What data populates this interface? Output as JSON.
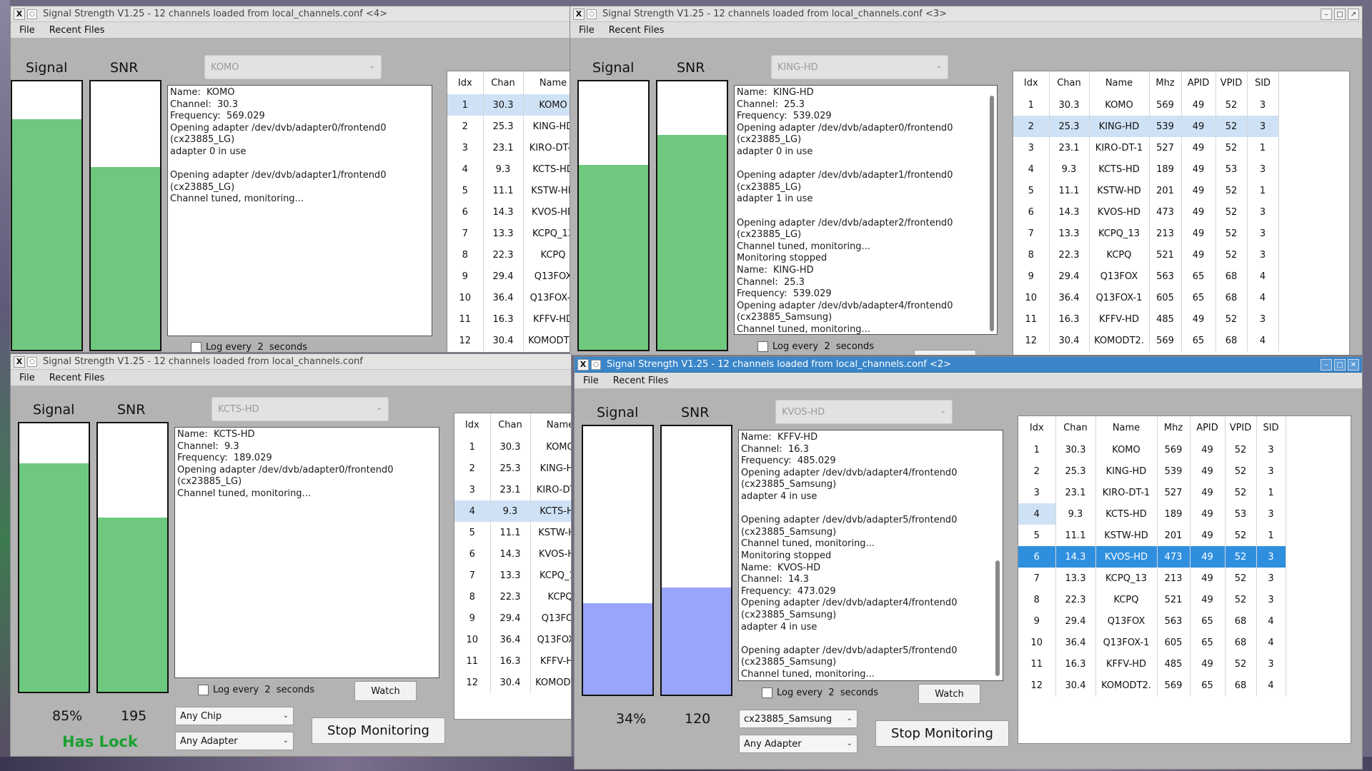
{
  "menu": {
    "file": "File",
    "recent": "Recent Files"
  },
  "labels": {
    "signal": "Signal",
    "snr": "SNR",
    "log_every": "Log every",
    "log_seconds": "2",
    "seconds": "seconds",
    "watch": "Watch",
    "stop": "Stop Monitoring",
    "has_lock": "Has Lock"
  },
  "colors": {
    "signal_fill_locked": "#6ec97f",
    "signal_fill_unlocked": "#99a4fb",
    "selected_row": "#2f8fdf",
    "lock_text": "#1aa030"
  },
  "table": {
    "headers": [
      "Idx",
      "Chan",
      "Name",
      "Mhz",
      "APID",
      "VPID",
      "SID"
    ],
    "rows": [
      [
        "1",
        "30.3",
        "KOMO",
        "569",
        "49",
        "52",
        "3"
      ],
      [
        "2",
        "25.3",
        "KING-HD",
        "539",
        "49",
        "52",
        "3"
      ],
      [
        "3",
        "23.1",
        "KIRO-DT-1",
        "527",
        "49",
        "52",
        "1"
      ],
      [
        "4",
        "9.3",
        "KCTS-HD",
        "189",
        "49",
        "53",
        "3"
      ],
      [
        "5",
        "11.1",
        "KSTW-HD",
        "201",
        "49",
        "52",
        "1"
      ],
      [
        "6",
        "14.3",
        "KVOS-HD",
        "473",
        "49",
        "52",
        "3"
      ],
      [
        "7",
        "13.3",
        "KCPQ_13",
        "213",
        "49",
        "52",
        "3"
      ],
      [
        "8",
        "22.3",
        "KCPQ",
        "521",
        "49",
        "52",
        "3"
      ],
      [
        "9",
        "29.4",
        "Q13FOX",
        "563",
        "65",
        "68",
        "4"
      ],
      [
        "10",
        "36.4",
        "Q13FOX-1",
        "605",
        "65",
        "68",
        "4"
      ],
      [
        "11",
        "16.3",
        "KFFV-HD",
        "485",
        "49",
        "52",
        "3"
      ],
      [
        "12",
        "30.4",
        "KOMODT2.",
        "569",
        "65",
        "68",
        "4"
      ]
    ]
  },
  "windows": {
    "w4": {
      "title": "Signal Strength V1.25 - 12 channels loaded from local_channels.conf <4>",
      "channel": "KOMO",
      "signal_level": 0.86,
      "snr_level": 0.68,
      "log": [
        "Name:  KOMO",
        "Channel:  30.3",
        "Frequency:  569.029",
        "Opening adapter /dev/dvb/adapter0/frontend0",
        "(cx23885_LG)",
        "adapter 0 in use",
        "",
        "Opening adapter /dev/dvb/adapter1/frontend0",
        "(cx23885_LG)",
        "Channel tuned, monitoring..."
      ],
      "selected_row": 0
    },
    "w3": {
      "title": "Signal Strength V1.25 - 12 channels loaded from local_channels.conf <3>",
      "channel": "KING-HD",
      "signal_level": 0.69,
      "snr_level": 0.8,
      "log": [
        "Name:  KING-HD",
        "Channel:  25.3",
        "Frequency:  539.029",
        "Opening adapter /dev/dvb/adapter0/frontend0",
        "(cx23885_LG)",
        "adapter 0 in use",
        "",
        "Opening adapter /dev/dvb/adapter1/frontend0",
        "(cx23885_LG)",
        "adapter 1 in use",
        "",
        "Opening adapter /dev/dvb/adapter2/frontend0",
        "(cx23885_LG)",
        "Channel tuned, monitoring...",
        "Monitoring stopped",
        "Name:  KING-HD",
        "Channel:  25.3",
        "Frequency:  539.029",
        "Opening adapter /dev/dvb/adapter4/frontend0",
        "(cx23885_Samsung)",
        "Channel tuned, monitoring..."
      ],
      "selected_row": 1
    },
    "w1": {
      "title": "Signal Strength V1.25 - 12 channels loaded from local_channels.conf",
      "channel": "KCTS-HD",
      "signal_level": 0.85,
      "snr_level": 0.65,
      "signal_text": "85%",
      "snr_text": "195",
      "log": [
        "Name:  KCTS-HD",
        "Channel:  9.3",
        "Frequency:  189.029",
        "Opening adapter /dev/dvb/adapter0/frontend0",
        "(cx23885_LG)",
        "Channel tuned, monitoring..."
      ],
      "chip": "Any Chip",
      "adapter": "Any Adapter",
      "selected_row": 3
    },
    "w2": {
      "title": "Signal Strength V1.25 - 12 channels loaded from local_channels.conf <2>",
      "channel": "KVOS-HD",
      "signal_level": 0.34,
      "snr_level": 0.4,
      "signal_text": "34%",
      "snr_text": "120",
      "log": [
        "Name:  KFFV-HD",
        "Channel:  16.3",
        "Frequency:  485.029",
        "Opening adapter /dev/dvb/adapter4/frontend0",
        "(cx23885_Samsung)",
        "adapter 4 in use",
        "",
        "Opening adapter /dev/dvb/adapter5/frontend0",
        "(cx23885_Samsung)",
        "Channel tuned, monitoring...",
        "Monitoring stopped",
        "Name:  KVOS-HD",
        "Channel:  14.3",
        "Frequency:  473.029",
        "Opening adapter /dev/dvb/adapter4/frontend0",
        "(cx23885_Samsung)",
        "adapter 4 in use",
        "",
        "Opening adapter /dev/dvb/adapter5/frontend0",
        "(cx23885_Samsung)",
        "Channel tuned, monitoring..."
      ],
      "chip": "cx23885_Samsung",
      "adapter": "Any Adapter",
      "selected_row": 5
    }
  }
}
